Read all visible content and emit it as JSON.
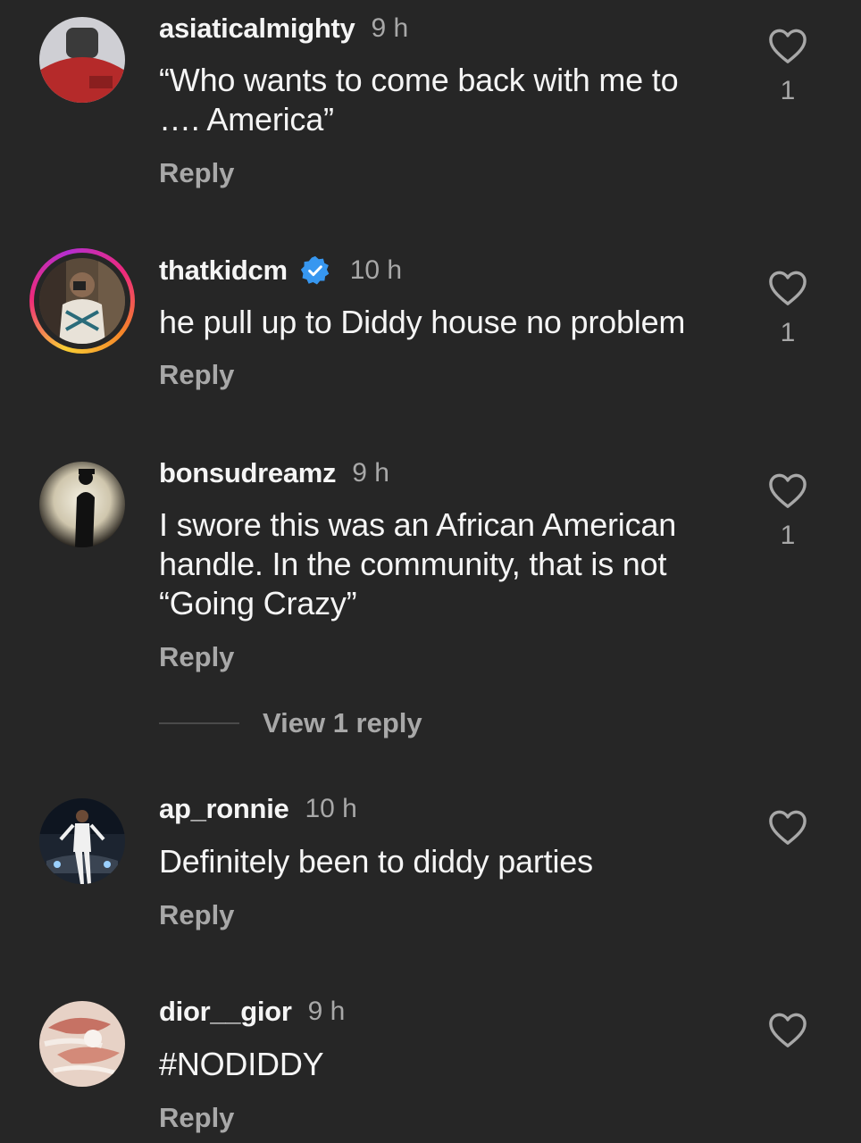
{
  "comments": [
    {
      "username": "asiaticalmighty",
      "time": "9 h",
      "text_lines": [
        "“Who wants to come back with  me to",
        "…. America”"
      ],
      "reply_label": "Reply",
      "likes": "1",
      "verified": false
    },
    {
      "username": "thatkidcm",
      "time": "10 h",
      "text_lines": [
        "he pull up to Diddy house no problem"
      ],
      "reply_label": "Reply",
      "likes": "1",
      "verified": true
    },
    {
      "username": "bonsudreamz",
      "time": "9 h",
      "text_lines": [
        "I swore this was an African American",
        "handle. In the community, that is not",
        "“Going Crazy”"
      ],
      "reply_label": "Reply",
      "likes": "1",
      "verified": false,
      "view_replies_label": "View 1 reply"
    },
    {
      "username": "ap_ronnie",
      "time": "10 h",
      "text_lines": [
        "Definitely been to diddy parties"
      ],
      "reply_label": "Reply",
      "likes": "",
      "verified": false
    },
    {
      "username": "dior__gior",
      "time": "9 h",
      "text_lines": [
        "#NODIDDY"
      ],
      "reply_label": "Reply",
      "likes": "",
      "verified": false
    }
  ],
  "icons": {
    "like": "heart-outline-icon",
    "verified": "verified-badge-icon"
  },
  "colors": {
    "background": "#262626",
    "primary_text": "#f5f5f5",
    "secondary_text": "#a8a8a8",
    "verified_blue": "#3797f0"
  }
}
